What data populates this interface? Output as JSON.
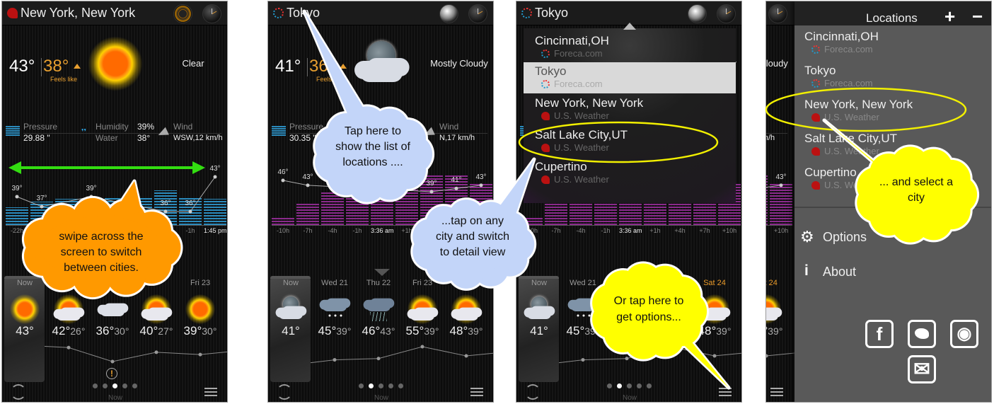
{
  "weather_panels": [
    {
      "title": "New York, New York",
      "source_icon": "us-weather-icon",
      "header_buttons": [
        "radar-icon",
        "clock-icon"
      ],
      "current": {
        "temp": "43°",
        "feels": "38°",
        "feels_label": "Feels like",
        "condition": "Clear",
        "icon": "sun"
      },
      "details": {
        "pressure_label": "Pressure",
        "pressure": "29.88 \"",
        "humidity_label": "Humidity",
        "humidity": "39%",
        "water_label": "Water",
        "water": "38°",
        "wind_label": "Wind",
        "wind": "WSW,12 km/h"
      },
      "hourly": {
        "bar_color": "#2b8bbd",
        "bar_levels": [
          36,
          47,
          53,
          53,
          57,
          57,
          70,
          57,
          53
        ],
        "temp_labels": [
          "39°",
          "37°",
          null,
          "39°",
          null,
          null,
          "36°",
          "36°",
          "43°"
        ],
        "hour_labels": [
          "-22h",
          null,
          null,
          null,
          null,
          null,
          null,
          "-1h",
          "1:45 pm"
        ],
        "now_index": 8
      },
      "daily": [
        {
          "day": "Now",
          "high": "43°",
          "low": null,
          "icon": "sun"
        },
        {
          "day": null,
          "high": "42°",
          "low": "26°",
          "icon": "sun-cloud"
        },
        {
          "day": null,
          "high": "36°",
          "low": "30°",
          "icon": "cloud"
        },
        {
          "day": null,
          "high": "40°",
          "low": "27°",
          "icon": "sun-cloud"
        },
        {
          "day": "Fri 23",
          "high": "39°",
          "low": "30°",
          "icon": "sun"
        }
      ],
      "alert_icon": "warning-icon",
      "pager": {
        "count": 5,
        "active": 2,
        "label": "Now"
      }
    },
    {
      "title": "Tokyo",
      "source_icon": "foreca-icon",
      "header_buttons": [
        "globe-icon",
        "clock-icon"
      ],
      "current": {
        "temp": "41°",
        "feels": "36°",
        "feels_label": "Feels like",
        "condition": "Mostly Cloudy",
        "icon": "moon-cloud"
      },
      "details": {
        "pressure_label": "Pressure",
        "pressure": "30.35 \"",
        "humidity_label": null,
        "humidity": null,
        "water_label": null,
        "water": null,
        "wind_label": "Wind",
        "wind": "N,17 km/h"
      },
      "hourly": {
        "bar_color": "#8a2a8c",
        "bar_levels": [
          16,
          44,
          66,
          100,
          100,
          100,
          100,
          100,
          83
        ],
        "temp_labels": [
          "46°",
          "43°",
          null,
          null,
          null,
          null,
          "39°",
          "41°",
          "43°"
        ],
        "hour_labels": [
          "-10h",
          "-7h",
          "-4h",
          "-1h",
          "3:36 am",
          "+1h",
          "+4h",
          "+7h",
          "+10h"
        ],
        "now_index": 4
      },
      "daily": [
        {
          "day": "Now",
          "high": "41°",
          "low": null,
          "icon": "moon-cloud"
        },
        {
          "day": "Wed 21",
          "high": "45°",
          "low": "39°",
          "icon": "snow"
        },
        {
          "day": "Thu 22",
          "high": "46°",
          "low": "43°",
          "icon": "rain"
        },
        {
          "day": "Fri 23",
          "high": "55°",
          "low": "39°",
          "icon": "sun-cloud"
        },
        {
          "day": "Sat 24",
          "high": "48°",
          "low": "39°",
          "icon": "sun-cloud",
          "highlight": true
        }
      ],
      "alert_icon": null,
      "pager": {
        "count": 5,
        "active": 1,
        "label": "Now"
      }
    }
  ],
  "location_dropdown": {
    "items": [
      {
        "name": "Cincinnati,OH",
        "source": "Foreca.com",
        "source_icon": "foreca-icon"
      },
      {
        "name": "Tokyo",
        "source": "Foreca.com",
        "source_icon": "foreca-icon",
        "selected": true
      },
      {
        "name": "New York, New York",
        "source": "U.S. Weather",
        "source_icon": "us-weather-icon"
      },
      {
        "name": "Salt Lake City,UT",
        "source": "U.S. Weather",
        "source_icon": "us-weather-icon"
      },
      {
        "name": "Cupertino",
        "source": "U.S. Weather",
        "source_icon": "us-weather-icon"
      }
    ]
  },
  "drawer": {
    "title": "Locations",
    "add_label": "+",
    "remove_label": "−",
    "items": [
      {
        "name": "Cincinnati,OH",
        "source": "Foreca.com",
        "source_icon": "foreca-icon"
      },
      {
        "name": "Tokyo",
        "source": "Foreca.com",
        "source_icon": "foreca-icon"
      },
      {
        "name": "New York, New York",
        "source": "U.S. Weather",
        "source_icon": "us-weather-icon"
      },
      {
        "name": "Salt Lake City,UT",
        "source": "U.S. Weather",
        "source_icon": "us-weather-icon"
      },
      {
        "name": "Cupertino",
        "source": "U.S. Weather",
        "source_icon": "us-weather-icon"
      }
    ],
    "options_label": "Options",
    "about_label": "About",
    "social": [
      "facebook-icon",
      "twitter-icon",
      "instagram-icon",
      "mail-icon"
    ]
  },
  "callouts": [
    {
      "lines": [
        "swipe across the",
        "screen to switch",
        "between cities."
      ],
      "color": "#ff9900"
    },
    {
      "lines": [
        "Tap here to",
        "show the list of",
        "locations ...."
      ],
      "color": "#c3d5f9"
    },
    {
      "lines": [
        "...tap on any",
        "city and switch",
        "to detail view"
      ],
      "color": "#c3d5f9"
    },
    {
      "lines": [
        "Or tap here to",
        "get options..."
      ],
      "color": "#ffff00"
    },
    {
      "lines": [
        "... and select a",
        "city"
      ],
      "color": "#ffff00"
    }
  ],
  "colors": {
    "accent_orange": "#e9a030",
    "swipe_arrow": "#33dd11",
    "highlight_ring": "#f2f000"
  }
}
